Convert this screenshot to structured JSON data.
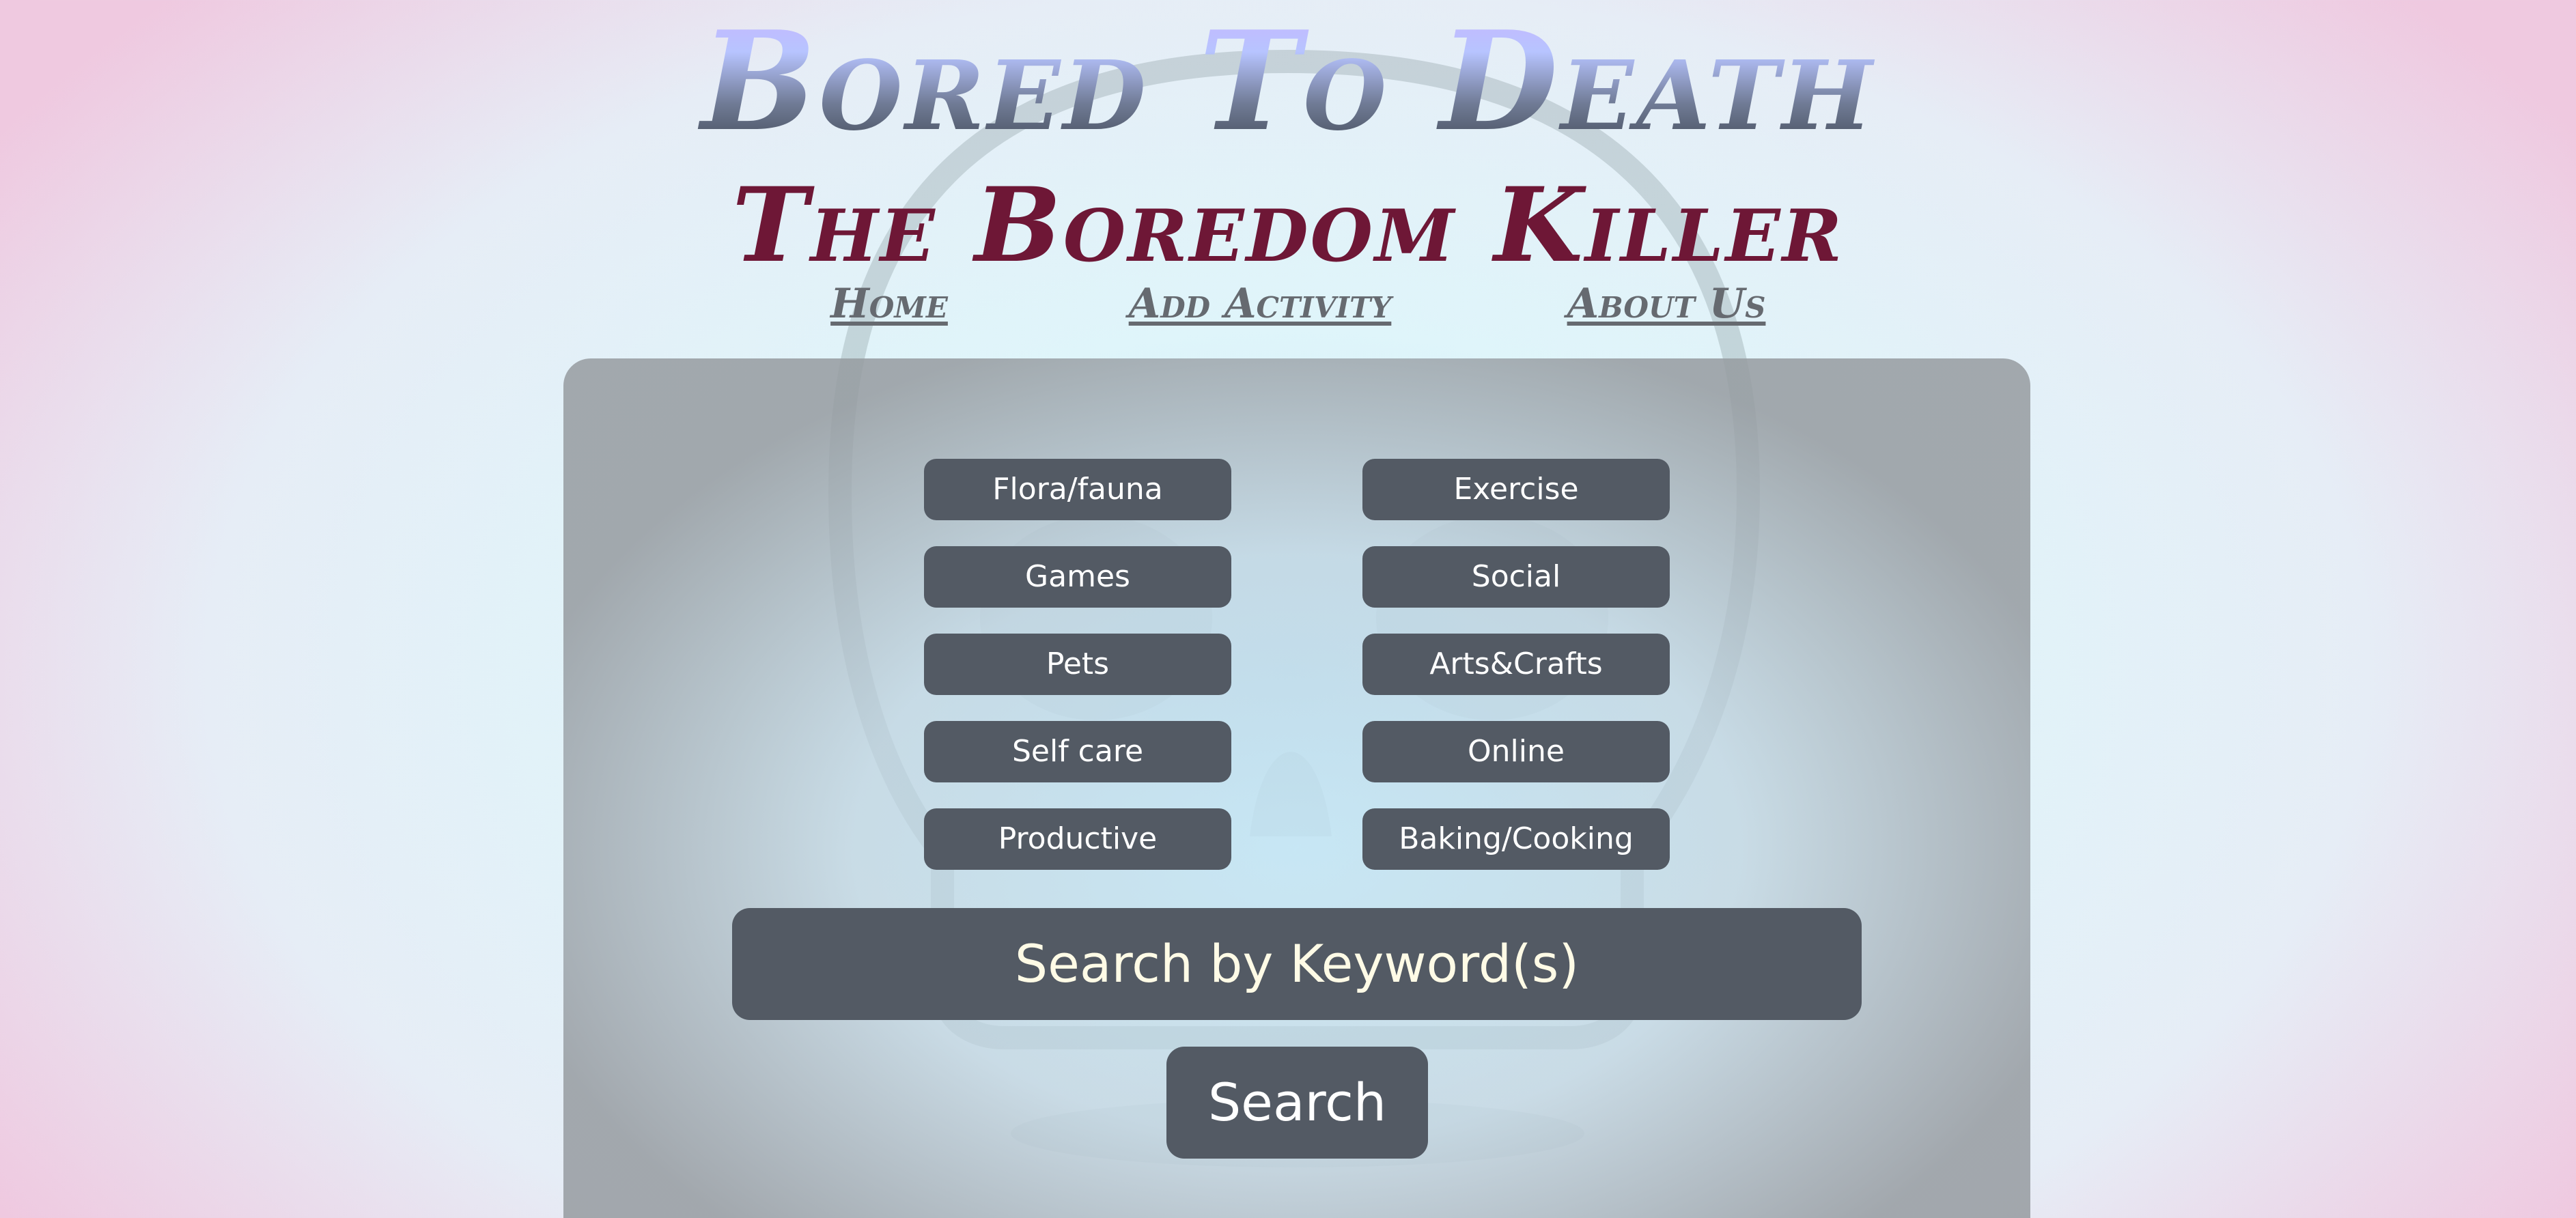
{
  "header": {
    "title": "Bored To Death",
    "subtitle": "The Boredom Killer"
  },
  "nav": {
    "items": [
      {
        "label": "Home"
      },
      {
        "label": "Add Activity"
      },
      {
        "label": "About Us"
      }
    ]
  },
  "categories": {
    "left": [
      "Flora/fauna",
      "Games",
      "Pets",
      "Self care",
      "Productive"
    ],
    "right": [
      "Exercise",
      "Social",
      "Arts&Crafts",
      "Online",
      "Baking/Cooking"
    ]
  },
  "search": {
    "keyword_placeholder": "Search by Keyword(s)",
    "button_label": "Search"
  },
  "colors": {
    "button_bg": "#535a64",
    "subtitle": "#6e1736",
    "nav_link": "#666a70"
  }
}
